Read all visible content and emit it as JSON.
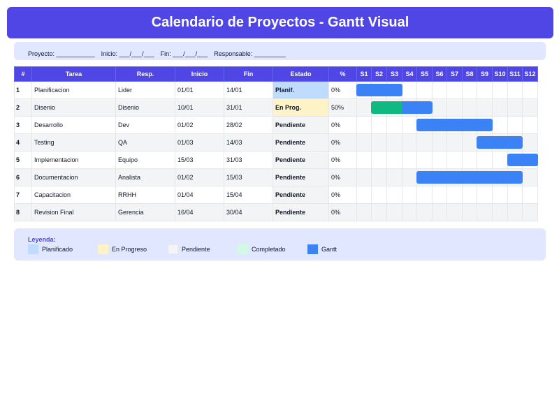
{
  "title": "Calendario de Proyectos - Gantt Visual",
  "meta": {
    "proyecto": "Proyecto: ___________",
    "inicio": "Inicio: ___/___/___",
    "fin": "Fin: ___/___/___",
    "responsable": "Responsable: _________"
  },
  "columns": {
    "num": "#",
    "tarea": "Tarea",
    "resp": "Resp.",
    "inicio": "Inicio",
    "fin": "Fin",
    "estado": "Estado",
    "pct": "%",
    "weeks": [
      "S1",
      "S2",
      "S3",
      "S4",
      "S5",
      "S6",
      "S7",
      "S8",
      "S9",
      "S10",
      "S11",
      "S12"
    ]
  },
  "tasks": [
    {
      "num": "1",
      "tarea": "Planificacion",
      "resp": "Lider",
      "inicio": "01/01",
      "fin": "14/01",
      "estado": "Planif.",
      "estado_type": "planif",
      "pct": "0%",
      "weeks": [
        1,
        2,
        3
      ],
      "done_weeks": []
    },
    {
      "num": "2",
      "tarea": "Disenio",
      "resp": "Disenio",
      "inicio": "10/01",
      "fin": "31/01",
      "estado": "En Prog.",
      "estado_type": "progreso",
      "pct": "50%",
      "weeks": [
        2,
        3,
        4,
        5
      ],
      "done_weeks": [
        2,
        3
      ]
    },
    {
      "num": "3",
      "tarea": "Desarrollo",
      "resp": "Dev",
      "inicio": "01/02",
      "fin": "28/02",
      "estado": "Pendiente",
      "estado_type": "pendiente",
      "pct": "0%",
      "weeks": [
        5,
        6,
        7,
        8,
        9
      ],
      "done_weeks": []
    },
    {
      "num": "4",
      "tarea": "Testing",
      "resp": "QA",
      "inicio": "01/03",
      "fin": "14/03",
      "estado": "Pendiente",
      "estado_type": "pendiente",
      "pct": "0%",
      "weeks": [
        9,
        10,
        11
      ],
      "done_weeks": []
    },
    {
      "num": "5",
      "tarea": "Implementacion",
      "resp": "Equipo",
      "inicio": "15/03",
      "fin": "31/03",
      "estado": "Pendiente",
      "estado_type": "pendiente",
      "pct": "0%",
      "weeks": [
        11,
        12
      ],
      "done_weeks": []
    },
    {
      "num": "6",
      "tarea": "Documentacion",
      "resp": "Analista",
      "inicio": "01/02",
      "fin": "15/03",
      "estado": "Pendiente",
      "estado_type": "pendiente",
      "pct": "0%",
      "weeks": [
        5,
        6,
        7,
        8,
        9,
        10,
        11
      ],
      "done_weeks": []
    },
    {
      "num": "7",
      "tarea": "Capacitacion",
      "resp": "RRHH",
      "inicio": "01/04",
      "fin": "15/04",
      "estado": "Pendiente",
      "estado_type": "pendiente",
      "pct": "0%",
      "weeks": [],
      "done_weeks": []
    },
    {
      "num": "8",
      "tarea": "Revision Final",
      "resp": "Gerencia",
      "inicio": "16/04",
      "fin": "30/04",
      "estado": "Pendiente",
      "estado_type": "pendiente",
      "pct": "0%",
      "weeks": [],
      "done_weeks": []
    }
  ],
  "legend": {
    "title": "Leyenda:",
    "items": [
      {
        "label": "Planificado",
        "color": "#bfdbfe",
        "border": "#bfdbfe"
      },
      {
        "label": "En Progreso",
        "color": "#fef3c7",
        "border": "#fef3c7"
      },
      {
        "label": "Pendiente",
        "color": "#f3f4f6",
        "border": "#e5e7eb"
      },
      {
        "label": "Completado",
        "color": "#d1fae5",
        "border": "#d1fae5"
      },
      {
        "label": "Gantt",
        "color": "#3b82f6",
        "border": "#3b82f6"
      }
    ]
  },
  "colors": {
    "primary": "#4f46e5",
    "panel": "#e0e7ff",
    "gantt": "#3b82f6",
    "gantt_done": "#10b981"
  }
}
